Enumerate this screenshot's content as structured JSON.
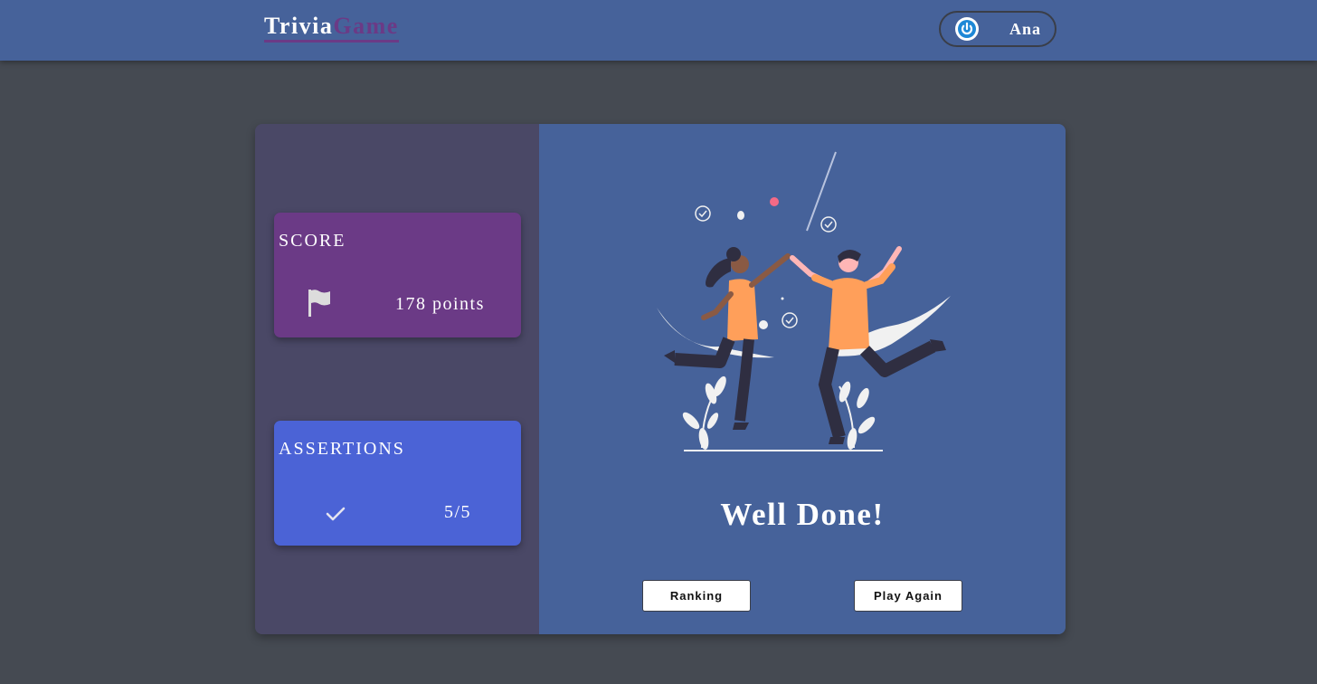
{
  "header": {
    "logo_part1": "Trivia",
    "logo_part2": "Game",
    "user_name": "Ana",
    "logout_icon": "power-icon"
  },
  "stats": {
    "score": {
      "title": "SCORE",
      "icon": "flag-icon",
      "value": "178 points"
    },
    "assertions": {
      "title": "ASSERTIONS",
      "icon": "check-icon",
      "value": "5/5"
    }
  },
  "result": {
    "illustration": "celebration-high-five-illustration",
    "message": "Well Done!"
  },
  "actions": {
    "ranking_label": "Ranking",
    "play_again_label": "Play Again"
  },
  "colors": {
    "header_bg": "#46629a",
    "page_bg": "#454a52",
    "score_bg": "#6b3a86",
    "assertions_bg": "#4b63d6",
    "left_panel_bg": "#4a4866",
    "accent_orange": "#ff9f5a"
  }
}
